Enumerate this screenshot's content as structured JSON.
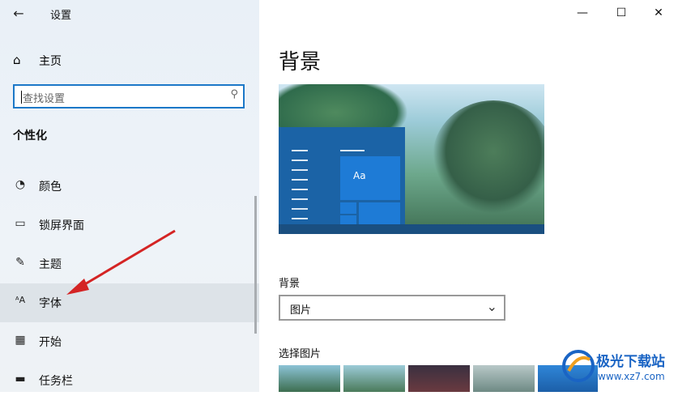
{
  "window": {
    "title": "设置",
    "minimize": "—",
    "maximize": "☐",
    "close": "✕"
  },
  "sidebar": {
    "home_label": "主页",
    "search_placeholder": "查找设置",
    "section_title": "个性化",
    "items": [
      {
        "label": "颜色",
        "icon": "palette-icon",
        "glyph": "🎨"
      },
      {
        "label": "锁屏界面",
        "icon": "lockscreen-icon",
        "glyph": "▭"
      },
      {
        "label": "主题",
        "icon": "theme-icon",
        "glyph": "✎"
      },
      {
        "label": "字体",
        "icon": "font-icon",
        "glyph": "AA",
        "selected": true
      },
      {
        "label": "开始",
        "icon": "start-icon",
        "glyph": "▦"
      },
      {
        "label": "任务栏",
        "icon": "taskbar-icon",
        "glyph": "▬"
      }
    ]
  },
  "main": {
    "heading": "背景",
    "preview_tile_text": "Aa",
    "background_label": "背景",
    "background_value": "图片",
    "choose_picture_label": "选择图片"
  },
  "watermark": {
    "brand": "极光下载站",
    "url": "www.xz7.com"
  },
  "colors": {
    "accent": "#1c78c8",
    "annotation_arrow": "#d42424"
  }
}
